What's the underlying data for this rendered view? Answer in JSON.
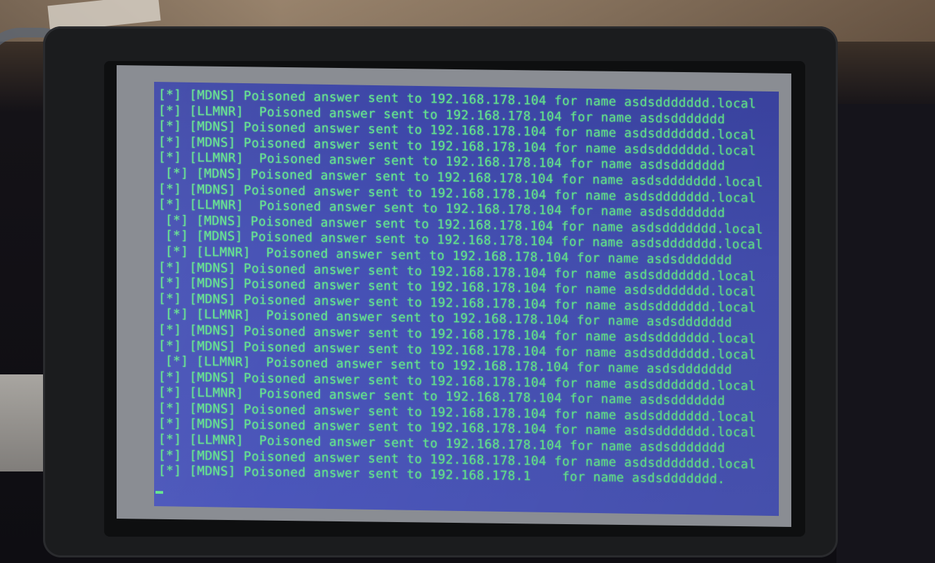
{
  "terminal": {
    "lines": [
      {
        "text": "[*] [MDNS] Poisoned answer sent to 192.168.178.104 for name asdsddddddd.local",
        "indent": false
      },
      {
        "text": "[*] [LLMNR]  Poisoned answer sent to 192.168.178.104 for name asdsddddddd",
        "indent": false
      },
      {
        "text": "[*] [MDNS] Poisoned answer sent to 192.168.178.104 for name asdsddddddd.local",
        "indent": false
      },
      {
        "text": "[*] [MDNS] Poisoned answer sent to 192.168.178.104 for name asdsddddddd.local",
        "indent": false
      },
      {
        "text": "[*] [LLMNR]  Poisoned answer sent to 192.168.178.104 for name asdsddddddd",
        "indent": false
      },
      {
        "text": "[*] [MDNS] Poisoned answer sent to 192.168.178.104 for name asdsddddddd.local",
        "indent": true
      },
      {
        "text": "[*] [MDNS] Poisoned answer sent to 192.168.178.104 for name asdsddddddd.local",
        "indent": false
      },
      {
        "text": "[*] [LLMNR]  Poisoned answer sent to 192.168.178.104 for name asdsddddddd",
        "indent": false
      },
      {
        "text": "[*] [MDNS] Poisoned answer sent to 192.168.178.104 for name asdsddddddd.local",
        "indent": true
      },
      {
        "text": "[*] [MDNS] Poisoned answer sent to 192.168.178.104 for name asdsddddddd.local",
        "indent": true
      },
      {
        "text": "[*] [LLMNR]  Poisoned answer sent to 192.168.178.104 for name asdsddddddd",
        "indent": true
      },
      {
        "text": "[*] [MDNS] Poisoned answer sent to 192.168.178.104 for name asdsddddddd.local",
        "indent": false
      },
      {
        "text": "[*] [MDNS] Poisoned answer sent to 192.168.178.104 for name asdsddddddd.local",
        "indent": false
      },
      {
        "text": "[*] [MDNS] Poisoned answer sent to 192.168.178.104 for name asdsddddddd.local",
        "indent": false
      },
      {
        "text": "[*] [LLMNR]  Poisoned answer sent to 192.168.178.104 for name asdsddddddd",
        "indent": true
      },
      {
        "text": "[*] [MDNS] Poisoned answer sent to 192.168.178.104 for name asdsddddddd.local",
        "indent": false
      },
      {
        "text": "[*] [MDNS] Poisoned answer sent to 192.168.178.104 for name asdsddddddd.local",
        "indent": false
      },
      {
        "text": "[*] [LLMNR]  Poisoned answer sent to 192.168.178.104 for name asdsddddddd",
        "indent": true
      },
      {
        "text": "[*] [MDNS] Poisoned answer sent to 192.168.178.104 for name asdsddddddd.local",
        "indent": false
      },
      {
        "text": "[*] [LLMNR]  Poisoned answer sent to 192.168.178.104 for name asdsddddddd",
        "indent": false
      },
      {
        "text": "[*] [MDNS] Poisoned answer sent to 192.168.178.104 for name asdsddddddd.local",
        "indent": false
      },
      {
        "text": "[*] [MDNS] Poisoned answer sent to 192.168.178.104 for name asdsddddddd.local",
        "indent": false
      },
      {
        "text": "[*] [LLMNR]  Poisoned answer sent to 192.168.178.104 for name asdsddddddd",
        "indent": false
      },
      {
        "text": "[*] [MDNS] Poisoned answer sent to 192.168.178.104 for name asdsddddddd.local",
        "indent": false
      },
      {
        "text": "[*] [MDNS] Poisoned answer sent to 192.168.178.1    for name asdsddddddd.",
        "indent": false
      }
    ]
  },
  "colors": {
    "screen_background": "#4550b4",
    "text": "#63e58b",
    "case": "#1b1c1e"
  }
}
